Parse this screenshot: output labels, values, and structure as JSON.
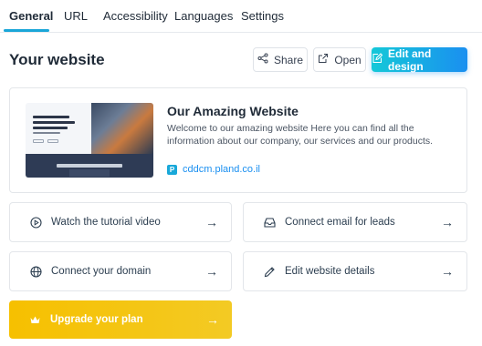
{
  "tabs": [
    {
      "label": "General",
      "active": true
    },
    {
      "label": "URL",
      "active": false
    },
    {
      "label": "Accessibility",
      "active": false
    },
    {
      "label": "Languages",
      "active": false
    },
    {
      "label": "Settings",
      "active": false
    }
  ],
  "header": {
    "title": "Your website",
    "share_label": "Share",
    "open_label": "Open",
    "edit_label": "Edit and design"
  },
  "website": {
    "name": "Our Amazing Website",
    "description": "Welcome to our amazing website Here you can find all the information about our company, our services and our products.",
    "domain": "cddcm.pland.co.il",
    "badge": "P"
  },
  "actions": {
    "tutorial": "Watch the tutorial video",
    "email": "Connect email for leads",
    "domain": "Connect your domain",
    "details": "Edit website details",
    "upgrade": "Upgrade your plan",
    "arrow": "→"
  },
  "colors": {
    "accent": "#1aa6d8",
    "primary_gradient_start": "#14c8d8",
    "primary_gradient_end": "#1a8ff0",
    "upgrade": "#f6c000",
    "link": "#1a8ff0"
  }
}
